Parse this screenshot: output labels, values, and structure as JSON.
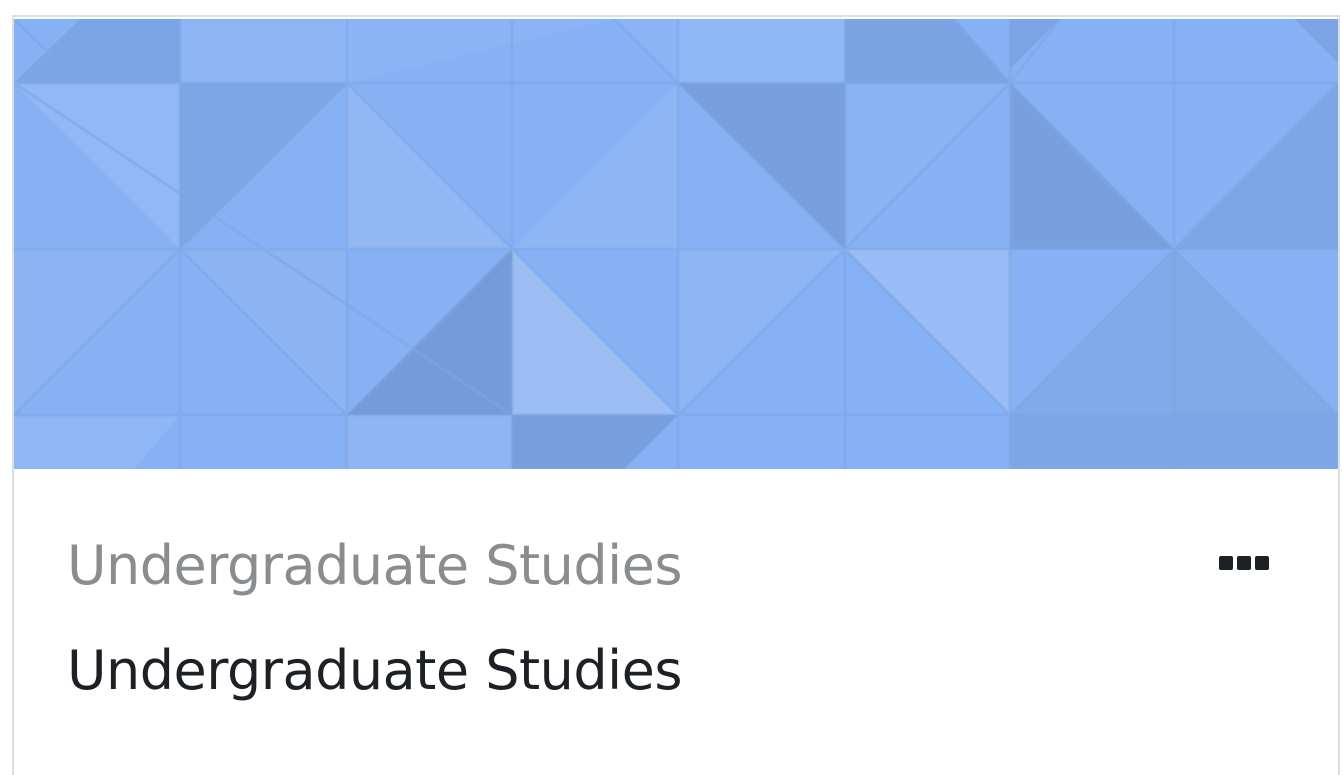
{
  "course_card": {
    "category": "Undergraduate Studies",
    "course_name": "Undergraduate Studies",
    "menu_icon": "more-options-icon",
    "banner_color": "#86b2f5",
    "text_color": "#1d2125",
    "muted_color": "#8a8d90"
  }
}
